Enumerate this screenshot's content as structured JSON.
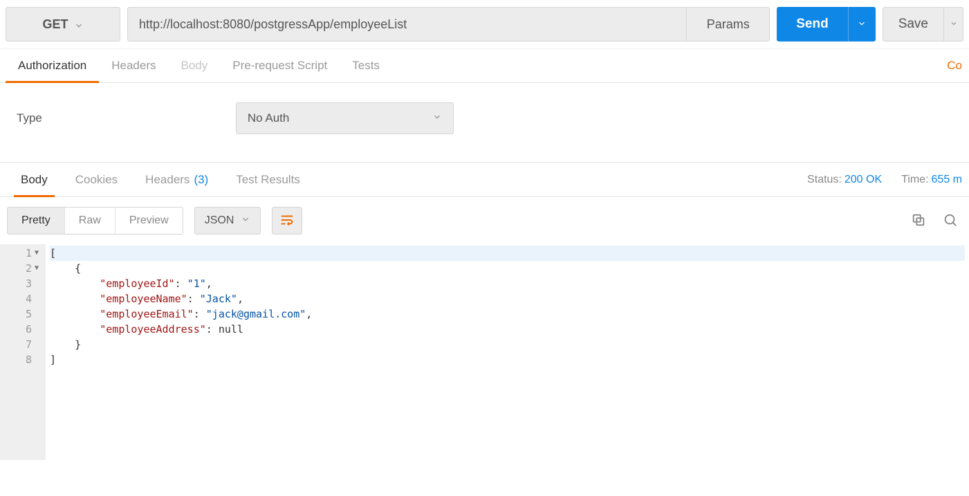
{
  "request": {
    "method": "GET",
    "url": "http://localhost:8080/postgressApp/employeeList",
    "params_btn": "Params",
    "send_btn": "Send",
    "save_btn": "Save"
  },
  "req_tabs": {
    "authorization": "Authorization",
    "headers": "Headers",
    "body": "Body",
    "prerequest": "Pre-request Script",
    "tests": "Tests",
    "cookies_link": "Co"
  },
  "auth": {
    "label": "Type",
    "selected": "No Auth"
  },
  "resp_tabs": {
    "body": "Body",
    "cookies": "Cookies",
    "headers": "Headers",
    "headers_count": "(3)",
    "test_results": "Test Results"
  },
  "status": {
    "status_label": "Status:",
    "status_value": "200 OK",
    "time_label": "Time:",
    "time_value": "655 m"
  },
  "resp_toolbar": {
    "pretty": "Pretty",
    "raw": "Raw",
    "preview": "Preview",
    "format": "JSON"
  },
  "response_body": {
    "lines": [
      {
        "n": "1",
        "fold": true,
        "indent": 0,
        "tokens": [
          {
            "t": "[",
            "c": ""
          }
        ]
      },
      {
        "n": "2",
        "fold": true,
        "indent": 1,
        "tokens": [
          {
            "t": "{",
            "c": ""
          }
        ]
      },
      {
        "n": "3",
        "fold": false,
        "indent": 2,
        "tokens": [
          {
            "t": "\"employeeId\"",
            "c": "k"
          },
          {
            "t": ": ",
            "c": ""
          },
          {
            "t": "\"1\"",
            "c": "s"
          },
          {
            "t": ",",
            "c": ""
          }
        ]
      },
      {
        "n": "4",
        "fold": false,
        "indent": 2,
        "tokens": [
          {
            "t": "\"employeeName\"",
            "c": "k"
          },
          {
            "t": ": ",
            "c": ""
          },
          {
            "t": "\"Jack\"",
            "c": "s"
          },
          {
            "t": ",",
            "c": ""
          }
        ]
      },
      {
        "n": "5",
        "fold": false,
        "indent": 2,
        "tokens": [
          {
            "t": "\"employeeEmail\"",
            "c": "k"
          },
          {
            "t": ": ",
            "c": ""
          },
          {
            "t": "\"jack@gmail.com\"",
            "c": "s"
          },
          {
            "t": ",",
            "c": ""
          }
        ]
      },
      {
        "n": "6",
        "fold": false,
        "indent": 2,
        "tokens": [
          {
            "t": "\"employeeAddress\"",
            "c": "k"
          },
          {
            "t": ": ",
            "c": ""
          },
          {
            "t": "null",
            "c": "nul"
          }
        ]
      },
      {
        "n": "7",
        "fold": false,
        "indent": 1,
        "tokens": [
          {
            "t": "}",
            "c": ""
          }
        ]
      },
      {
        "n": "8",
        "fold": false,
        "indent": 0,
        "tokens": [
          {
            "t": "]",
            "c": ""
          }
        ]
      }
    ]
  }
}
